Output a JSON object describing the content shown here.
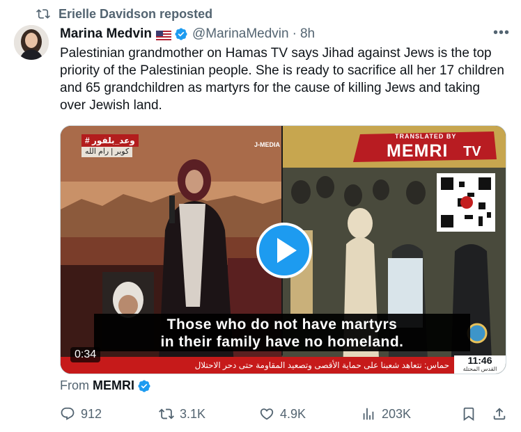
{
  "repost": {
    "label": "Erielle Davidson reposted"
  },
  "author": {
    "name": "Marina Medvin",
    "handle": "@MarinaMedvin",
    "separator": "·",
    "time": "8h",
    "flag_icon": "us-flag-icon",
    "verified_icon": "verified-badge-icon"
  },
  "tweet": {
    "text": "Palestinian grandmother on Hamas TV says Jihad against Jews is the top priority of the Palestinian people. She is ready to sacrifice all her 17 children and 65 grandchildren as martyrs for the cause of killing Jews and taking over Jewish land."
  },
  "media": {
    "subtitle_line1": "Those who do not have martyrs",
    "subtitle_line2": "in their family have no homeland.",
    "duration": "0:34",
    "banner_translated": "TRANSLATED BY",
    "banner_logo": "MEMRI",
    "banner_tv": "TV",
    "tv_tag": "# وعد_بلفور",
    "tv_tag2": "كوبر | رام الله",
    "channel": "J-MEDIA",
    "ticker": "حماس: نتعاهد شعبنا على حماية الأقصى وتصعيد المقاومة حتى دحر الاحتلال",
    "clock_time": "11:46",
    "clock_sub": "القدس المحتلة"
  },
  "source": {
    "prefix": "From",
    "name": "MEMRI"
  },
  "actions": {
    "replies": "912",
    "reposts": "3.1K",
    "likes": "4.9K",
    "views": "203K"
  },
  "colors": {
    "accent": "#1d9bf0",
    "muted": "#536471",
    "text": "#0f1419",
    "ticker": "#c61a1a"
  }
}
